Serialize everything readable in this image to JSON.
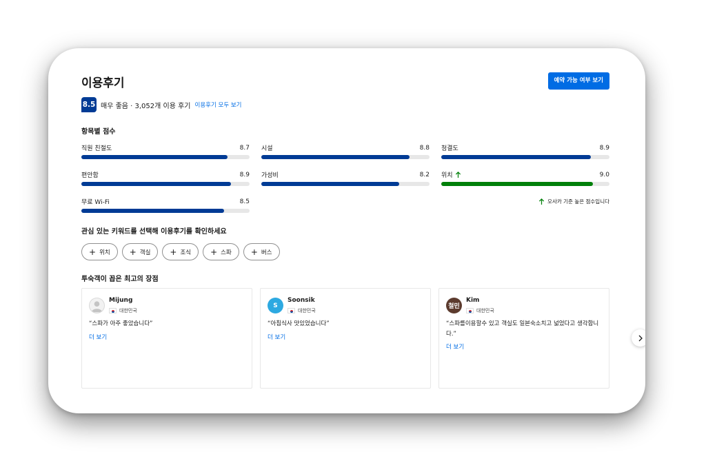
{
  "header": {
    "title": "이용후기",
    "availability_button": "예약 가능 여부 보기"
  },
  "summary": {
    "score": "8.5",
    "text": "매우 좋음 · 3,052개 이용 후기",
    "link": "이용후기 모두 보기"
  },
  "categories": {
    "heading": "항목별 점수",
    "items": [
      {
        "label": "직원 친절도",
        "score": "8.7",
        "fill": 0.87
      },
      {
        "label": "시설",
        "score": "8.8",
        "fill": 0.88
      },
      {
        "label": "청결도",
        "score": "8.9",
        "fill": 0.89
      },
      {
        "label": "편안함",
        "score": "8.9",
        "fill": 0.89
      },
      {
        "label": "가성비",
        "score": "8.2",
        "fill": 0.82
      },
      {
        "label": "위치",
        "score": "9.0",
        "fill": 0.9,
        "highlight": true
      },
      {
        "label": "무료 Wi-Fi",
        "score": "8.5",
        "fill": 0.85
      }
    ],
    "note": "오사카 기준 높은 점수입니다"
  },
  "keywords": {
    "heading": "관심 있는 키워드를 선택해 이용후기를 확인하세요",
    "chips": [
      "위치",
      "객실",
      "조식",
      "스파",
      "버스"
    ]
  },
  "best": {
    "heading": "투숙객이 꼽은 최고의 장점",
    "reviews": [
      {
        "name": "Mijung",
        "country": "대한민국",
        "avatar": "",
        "text": "“스파가 아주 좋았습니다”",
        "more": "더 보기"
      },
      {
        "name": "Soonsik",
        "country": "대한민국",
        "avatar": "S",
        "text": "“아침식사 맛있었습니다”",
        "more": "더 보기"
      },
      {
        "name": "Kim",
        "country": "대한민국",
        "avatar": "철민",
        "text": "“스파를이용할수 있고 객실도 일본숙소치고 넓었다고 생각합니다.”",
        "more": "더 보기"
      }
    ]
  },
  "colors": {
    "brand": "#003b95",
    "link": "#006ce4",
    "positive": "#008009"
  },
  "icons": {
    "up_arrow": "arrow-up-icon",
    "next": "chevron-right-icon",
    "plus": "plus-icon",
    "flag": "korea-flag-icon"
  }
}
